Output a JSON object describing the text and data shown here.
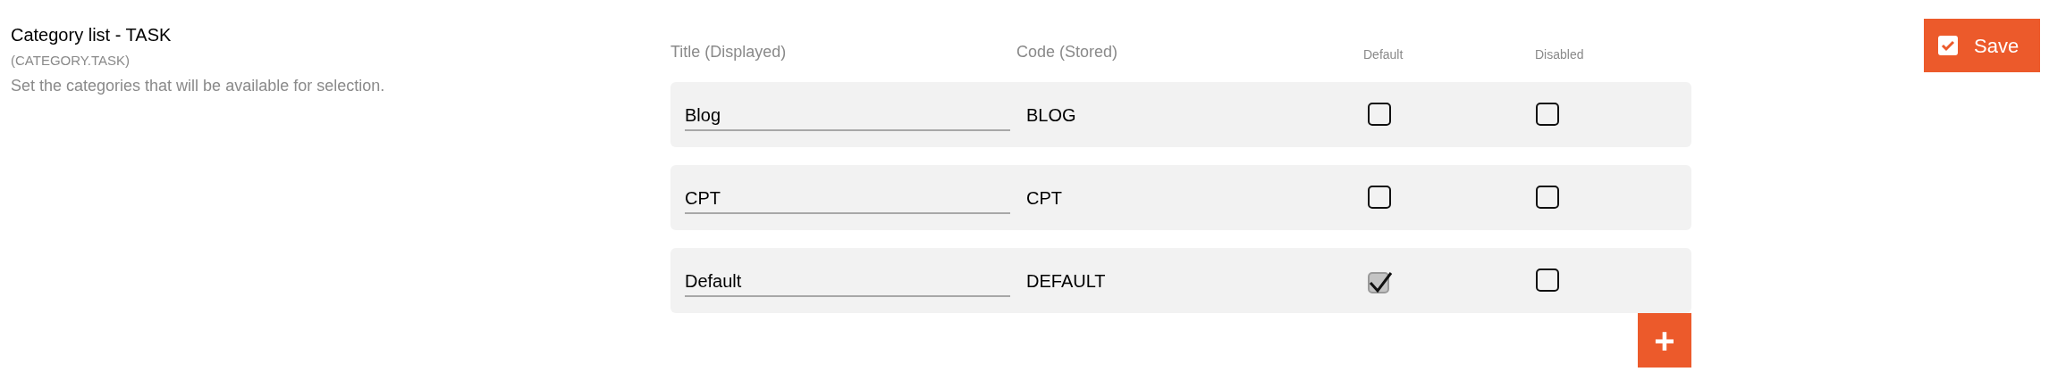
{
  "setting": {
    "title": "Category list - TASK",
    "key": "(CATEGORY.TASK)",
    "description": "Set the categories that will be available for selection."
  },
  "table": {
    "columns": [
      "Title (Displayed)",
      "Code (Stored)",
      "Default",
      "Disabled"
    ],
    "rows": [
      {
        "title": "Blog",
        "code": "BLOG",
        "default": false,
        "disabled": false
      },
      {
        "title": "CPT",
        "code": "CPT",
        "default": false,
        "disabled": false
      },
      {
        "title": "Default",
        "code": "DEFAULT",
        "default": true,
        "disabled": false
      }
    ]
  },
  "save_button": {
    "label": "Save"
  },
  "add_button": {
    "label": "+"
  }
}
